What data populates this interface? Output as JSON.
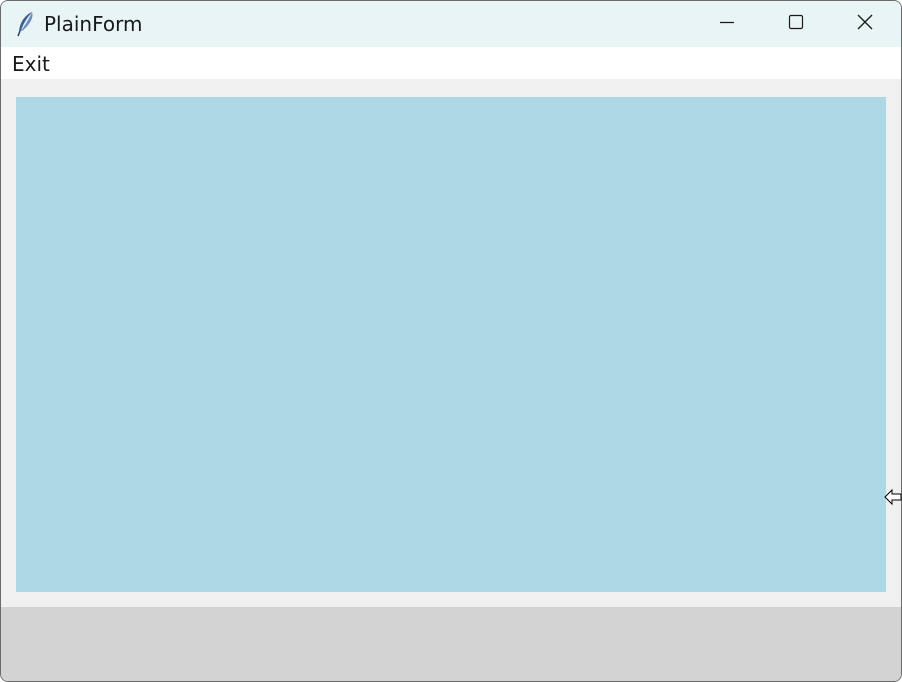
{
  "window": {
    "title": "PlainForm",
    "icon": "feather-icon",
    "controls": {
      "minimize": "minimize-icon",
      "maximize": "maximize-icon",
      "close": "close-icon"
    }
  },
  "menubar": {
    "items": [
      {
        "label": "Exit"
      }
    ]
  },
  "colors": {
    "titlebar": "#e8f4f5",
    "canvas": "#add8e6",
    "statusbar": "#d3d3d3",
    "background": "#f0f0f0"
  },
  "cursor": "resize-left-arrow-icon"
}
